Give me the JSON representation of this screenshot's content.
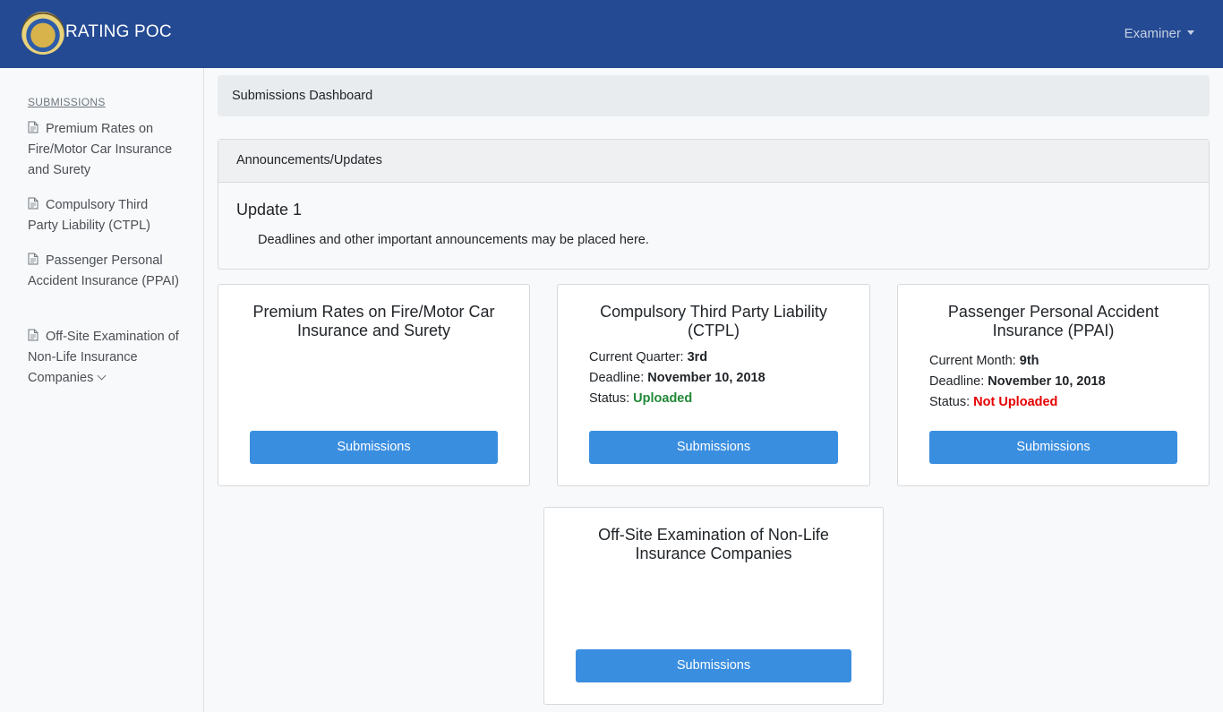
{
  "app": {
    "brand": "RATING POC",
    "user_menu": "Examiner"
  },
  "icons": {
    "logo": "seal-logo",
    "doc": "document-icon",
    "dropdown": "caret-down-icon",
    "expand": "chevron-down-icon"
  },
  "sidebar": {
    "heading": "SUBMISSIONS",
    "items": [
      {
        "label": "Premium Rates on Fire/Motor Car Insurance and Surety"
      },
      {
        "label": "Compulsory Third Party Liability (CTPL)"
      },
      {
        "label": "Passenger Personal Accident Insurance (PPAI)"
      },
      {
        "label": "Off-Site Examination of Non-Life Insurance Companies"
      }
    ]
  },
  "breadcrumb": {
    "label": "Submissions Dashboard"
  },
  "announcements": {
    "header": "Announcements/Updates",
    "title": "Update 1",
    "body": "Deadlines and other important announcements may be placed here."
  },
  "cards": [
    {
      "title": "Premium Rates on Fire/Motor Car Insurance and Surety",
      "button": "Submissions"
    },
    {
      "title": "Compulsory Third Party Liability (CTPL)",
      "period_label": "Current Quarter: ",
      "period_value": "3rd",
      "deadline_label": "Deadline: ",
      "deadline_value": "November 10, 2018",
      "status_label": "Status: ",
      "status_value": "Uploaded",
      "button": "Submissions"
    },
    {
      "title": "Passenger Personal Accident Insurance (PPAI)",
      "period_label": "Current Month: ",
      "period_value": "9th",
      "deadline_label": "Deadline: ",
      "deadline_value": "November 10, 2018",
      "status_label": "Status: ",
      "status_value": "Not Uploaded",
      "button": "Submissions"
    },
    {
      "title": "Off-Site Examination of Non-Life Insurance Companies",
      "button": "Submissions"
    }
  ],
  "colors": {
    "navbar": "#244a93",
    "button": "#3a8ee0",
    "status_uploaded": "#218838",
    "status_not_uploaded": "#e60000"
  }
}
